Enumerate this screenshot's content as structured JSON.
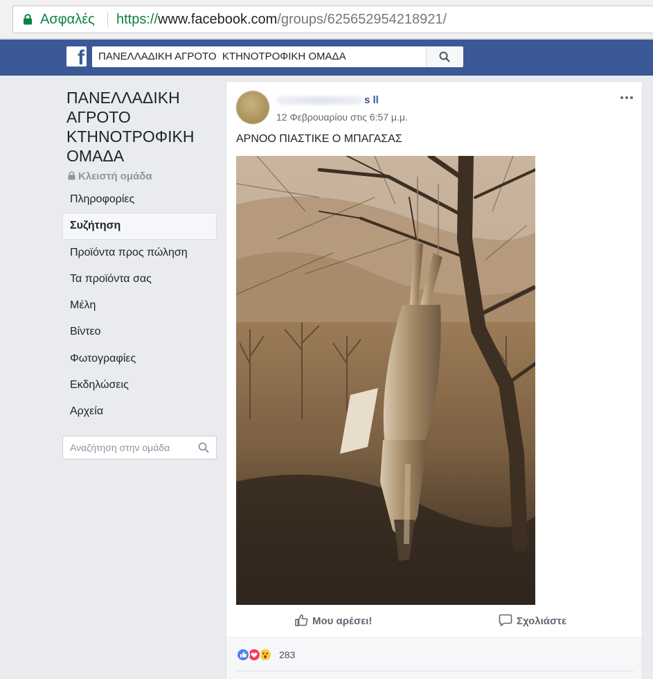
{
  "browser": {
    "secure_label": "Ασφαλές",
    "url_scheme": "https://",
    "url_host": "www.facebook.com",
    "url_path": "/groups/625652954218921/"
  },
  "facebook_bar": {
    "logo_letter": "f",
    "search_value": "ΠΑΝΕΛΛΑΔΙΚΗ ΑΓΡΟΤΟ  ΚΤΗΝΟΤΡΟΦΙΚΗ ΟΜΑΔΑ",
    "brand_color": "#3b5998"
  },
  "sidebar": {
    "group_name": "ΠΑΝΕΛΛΑΔΙΚΗ ΑΓΡΟΤΟ ΚΤΗΝΟΤΡΟΦΙΚΗ ΟΜΑΔΑ",
    "privacy_label": "Κλειστή ομάδα",
    "items": [
      {
        "label": "Πληροφορίες",
        "active": false
      },
      {
        "label": "Συζήτηση",
        "active": true
      },
      {
        "label": "Προϊόντα προς πώληση",
        "active": false
      },
      {
        "label": "Τα προϊόντα σας",
        "active": false
      },
      {
        "label": "Μέλη",
        "active": false
      },
      {
        "label": "Βίντεο",
        "active": false
      },
      {
        "label": "Φωτογραφίες",
        "active": false
      },
      {
        "label": "Εκδηλώσεις",
        "active": false
      },
      {
        "label": "Αρχεία",
        "active": false
      }
    ],
    "search_placeholder": "Αναζήτηση στην ομάδα"
  },
  "post": {
    "author_suffix": "s ll",
    "timestamp": "12 Φεβρουαρίου στις 6:57 μ.μ.",
    "text": "ΑΡΝΟΟ ΠΙΑΣΤΙΚΕ Ο ΜΠΑΓΑΣΑΣ",
    "like_label": "Μου αρέσει!",
    "comment_label": "Σχολιάστε",
    "reaction_count": "283",
    "reaction_icons": [
      "like-reaction-icon",
      "love-reaction-icon",
      "wow-reaction-icon"
    ]
  }
}
